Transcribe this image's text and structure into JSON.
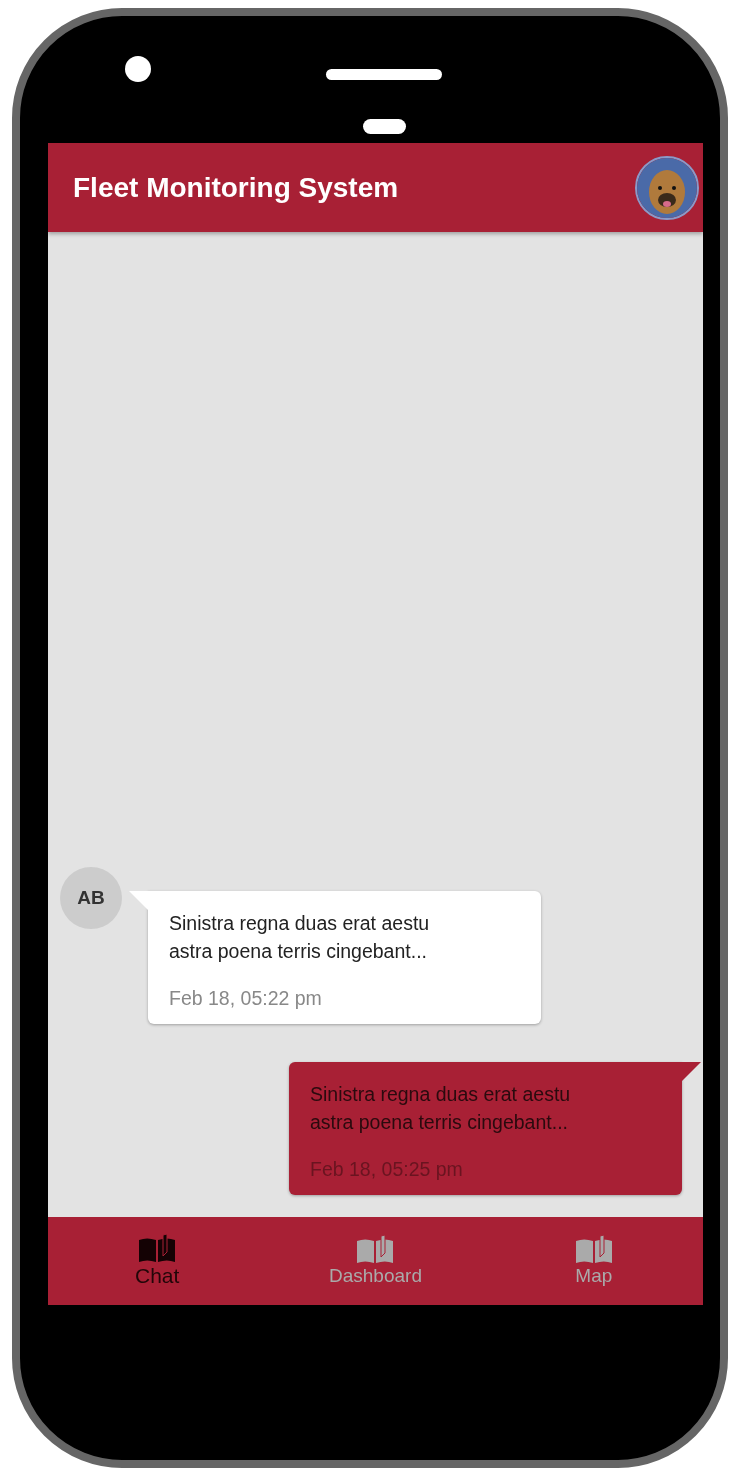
{
  "app_bar": {
    "title": "Fleet Monitoring System"
  },
  "messages": [
    {
      "kind": "received",
      "avatar": "AB",
      "text": "Sinistra regna duas erat aestu astra poena terris cingebant...",
      "time": "Feb 18, 05:22 pm"
    },
    {
      "kind": "sent",
      "text": "Sinistra regna duas erat aestu astra poena terris cingebant...",
      "time": "Feb 18, 05:25 pm"
    }
  ],
  "bottom_nav": [
    {
      "label": "Chat",
      "selected": true
    },
    {
      "label": "Dashboard",
      "selected": false
    },
    {
      "label": "Map",
      "selected": false
    }
  ]
}
